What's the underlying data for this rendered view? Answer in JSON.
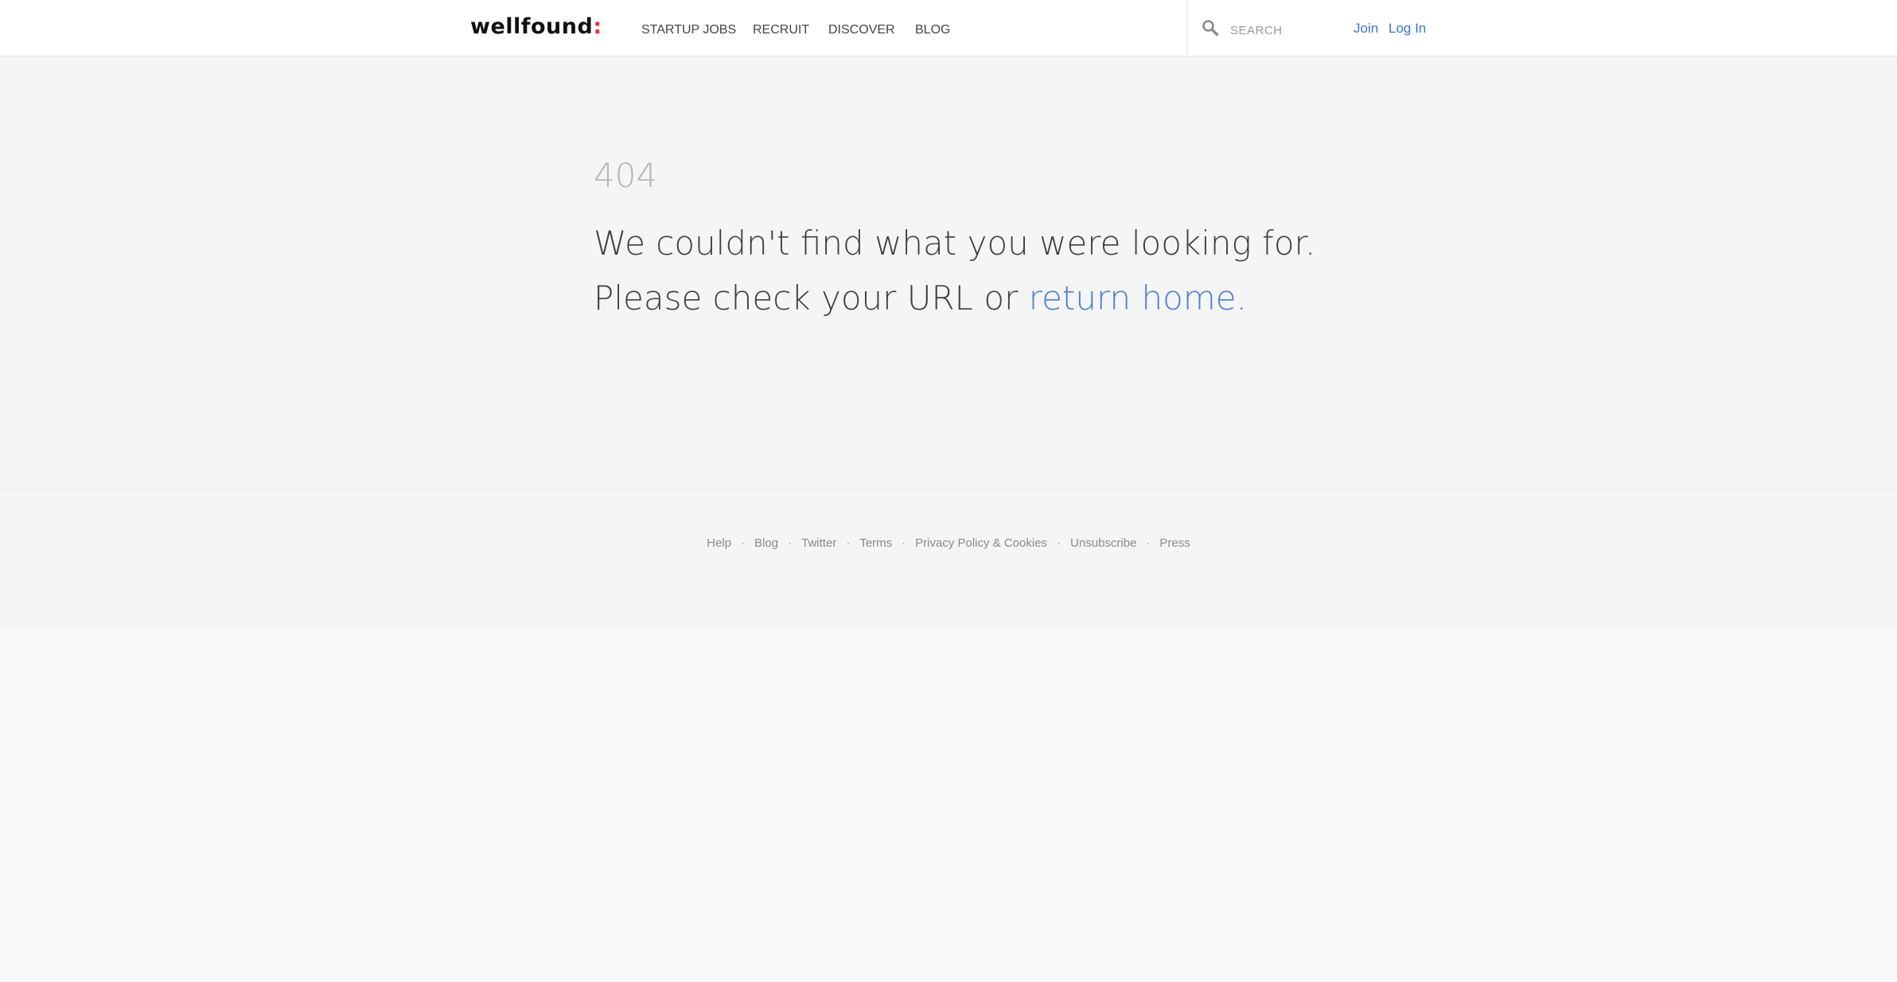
{
  "header": {
    "logo_text": "wellfound",
    "logo_accent": ":",
    "nav": [
      "STARTUP JOBS",
      "RECRUIT",
      "DISCOVER",
      "BLOG"
    ],
    "search": {
      "placeholder": "SEARCH",
      "value": ""
    },
    "join_label": "Join",
    "login_label": "Log In"
  },
  "error": {
    "code": "404",
    "line1": "We couldn't find what you were looking for.",
    "line2_prefix": "Please check your URL or ",
    "line2_link": "return home",
    "line2_suffix": "."
  },
  "footer": {
    "links": [
      "Help",
      "Blog",
      "Twitter",
      "Terms",
      "Privacy Policy & Cookies",
      "Unsubscribe",
      "Press"
    ],
    "separator": "·"
  },
  "colors": {
    "brand_accent": "#ec2e3a",
    "link": "#3b74c9",
    "background": "#f5f5f5"
  },
  "icons": {
    "search": "search-icon",
    "logo": "wellfound-logo"
  }
}
